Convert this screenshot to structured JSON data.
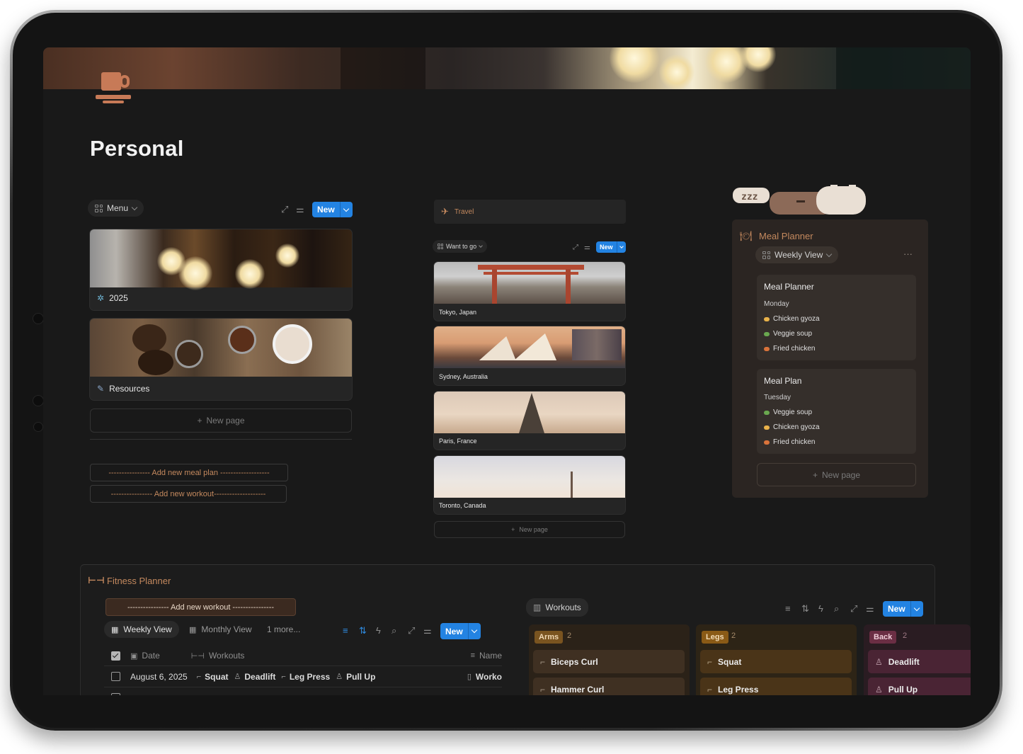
{
  "page": {
    "title": "Personal"
  },
  "menu": {
    "view_label": "Menu",
    "new_label": "New",
    "cards": [
      {
        "label": "2025",
        "icon": "sparkle-icon"
      },
      {
        "label": "Resources",
        "icon": "tool-icon"
      }
    ],
    "new_page_label": "New page",
    "buttons": [
      "---------------- Add new meal plan -------------------",
      "---------------- Add new workout--------------------"
    ]
  },
  "travel": {
    "title": "Travel",
    "view_label": "Want to go",
    "new_label": "New",
    "cards": [
      "Tokyo, Japan",
      "Sydney, Australia",
      "Paris, France",
      "Toronto, Canada"
    ],
    "new_page_label": "New page"
  },
  "meal_planner": {
    "title": "Meal Planner",
    "view_label": "Weekly View",
    "more_label": "···",
    "cards": [
      {
        "title": "Meal Planner",
        "day": "Monday",
        "items": [
          "Chicken gyoza",
          "Veggie soup",
          "Fried chicken"
        ]
      },
      {
        "title": "Meal Plan",
        "day": "Tuesday",
        "items": [
          "Veggie soup",
          "Chicken gyoza",
          "Fried chicken"
        ]
      }
    ],
    "new_page_label": "New page",
    "colors": {
      "gyoza": "#e9b24a",
      "soup": "#6aa84f",
      "chicken": "#d9733b"
    }
  },
  "fitness": {
    "title": "Fitness Planner",
    "add_button": "---------------- Add new workout ----------------",
    "tabs": [
      "Weekly View",
      "Monthly View",
      "1 more..."
    ],
    "new_label": "New",
    "columns": {
      "date": "Date",
      "workouts": "Workouts",
      "name": "Name"
    },
    "rows": [
      {
        "date": "August 6, 2025",
        "workouts": [
          "Squat",
          "Deadlift",
          "Leg Press",
          "Pull Up"
        ],
        "name": "Worko"
      }
    ],
    "board": {
      "view_label": "Workouts",
      "new_label": "New",
      "groups": [
        {
          "name": "Arms",
          "count": "2",
          "items": [
            "Biceps Curl",
            "Hammer Curl"
          ]
        },
        {
          "name": "Legs",
          "count": "2",
          "items": [
            "Squat",
            "Leg Press"
          ]
        },
        {
          "name": "Back",
          "count": "2",
          "items": [
            "Deadlift",
            "Pull Up"
          ]
        }
      ]
    }
  },
  "colors": {
    "accent": "#c4895e",
    "blue": "#2383e2",
    "bg": "#191919"
  }
}
